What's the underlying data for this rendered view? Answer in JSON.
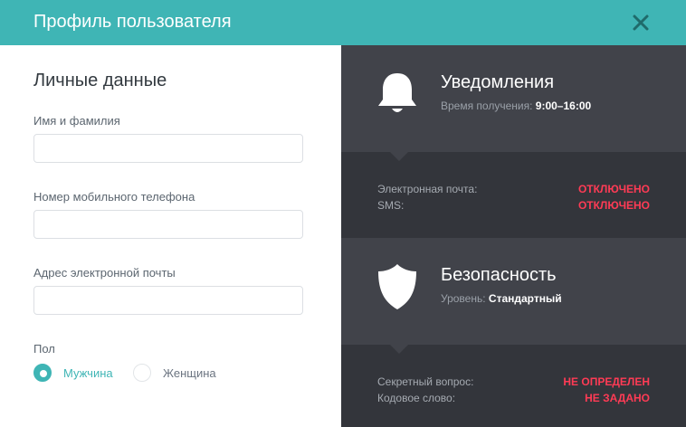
{
  "header": {
    "title": "Профиль пользователя"
  },
  "personal": {
    "section_title": "Личные данные",
    "fields": [
      {
        "label": "Имя и фамилия",
        "value": "",
        "placeholder": ""
      },
      {
        "label": "Номер мобильного телефона",
        "value": "",
        "placeholder": ""
      },
      {
        "label": "Адрес электронной почты",
        "value": "",
        "placeholder": ""
      }
    ],
    "gender": {
      "label": "Пол",
      "options": [
        {
          "label": "Мужчина",
          "selected": true
        },
        {
          "label": "Женщина",
          "selected": false
        }
      ]
    }
  },
  "notifications": {
    "title": "Уведомления",
    "subtitle_label": "Время получения:",
    "subtitle_value": "9:00–16:00",
    "rows": [
      {
        "label": "Электронная почта:",
        "value": "ОТКЛЮЧЕНО"
      },
      {
        "label": "SMS:",
        "value": "ОТКЛЮЧЕНО"
      }
    ]
  },
  "security": {
    "title": "Безопасность",
    "subtitle_label": "Уровень:",
    "subtitle_value": "Стандартный",
    "rows": [
      {
        "label": "Секретный вопрос:",
        "value": "НЕ ОПРЕДЕЛЕН"
      },
      {
        "label": "Кодовое слово:",
        "value": "НЕ ЗАДАНО"
      }
    ]
  },
  "colors": {
    "accent": "#3fb5b5",
    "panel_dark": "#41434a",
    "panel_darker": "#33353b",
    "status_red": "#ff3b55"
  },
  "icons": {
    "close": "close-icon",
    "notifications": "bell-icon",
    "security": "shield-icon"
  }
}
